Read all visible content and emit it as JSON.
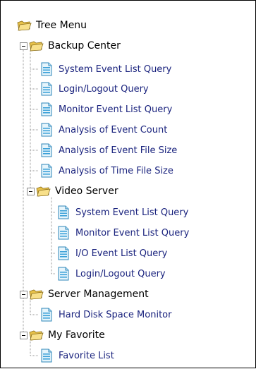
{
  "tree": {
    "root": "Tree Menu",
    "backup_center": {
      "label": "Backup Center",
      "items": [
        "System Event List Query",
        "Login/Logout Query",
        "Monitor Event List Query",
        "Analysis of Event Count",
        "Analysis of Event File Size",
        "Analysis of Time File Size"
      ]
    },
    "video_server": {
      "label": "Video Server",
      "items": [
        "System Event List Query",
        "Monitor Event List Query",
        "I/O Event List Query",
        "Login/Logout Query"
      ]
    },
    "server_management": {
      "label": "Server Management",
      "items": [
        "Hard Disk Space Monitor"
      ]
    },
    "my_favorite": {
      "label": "My Favorite",
      "items": [
        "Favorite List"
      ]
    }
  },
  "icons": {
    "folder": "open-folder-icon",
    "page": "document-page-icon",
    "toggle": "collapse-toggle-icon"
  },
  "colors": {
    "folder_yellow": "#f5d76e",
    "page_blue": "#3aa0d8",
    "leaf_text": "#1a237e"
  }
}
